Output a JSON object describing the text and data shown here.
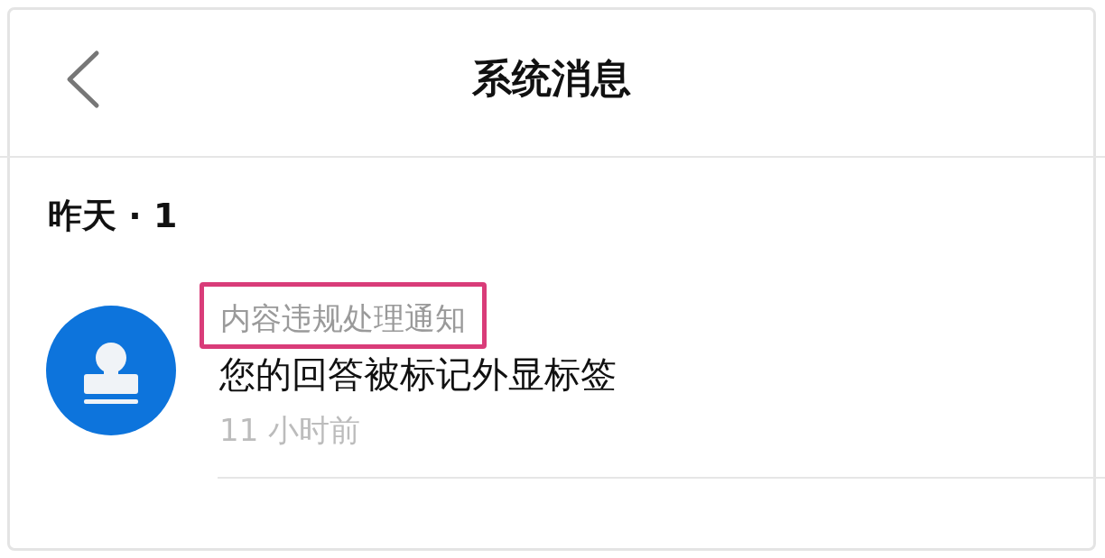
{
  "header": {
    "title": "系统消息"
  },
  "section": {
    "label": "昨天 · 1"
  },
  "messages": [
    {
      "title": "内容违规处理通知",
      "highlighted": true,
      "body": "您的回答被标记外显标签",
      "time": "11 小时前"
    }
  ]
}
